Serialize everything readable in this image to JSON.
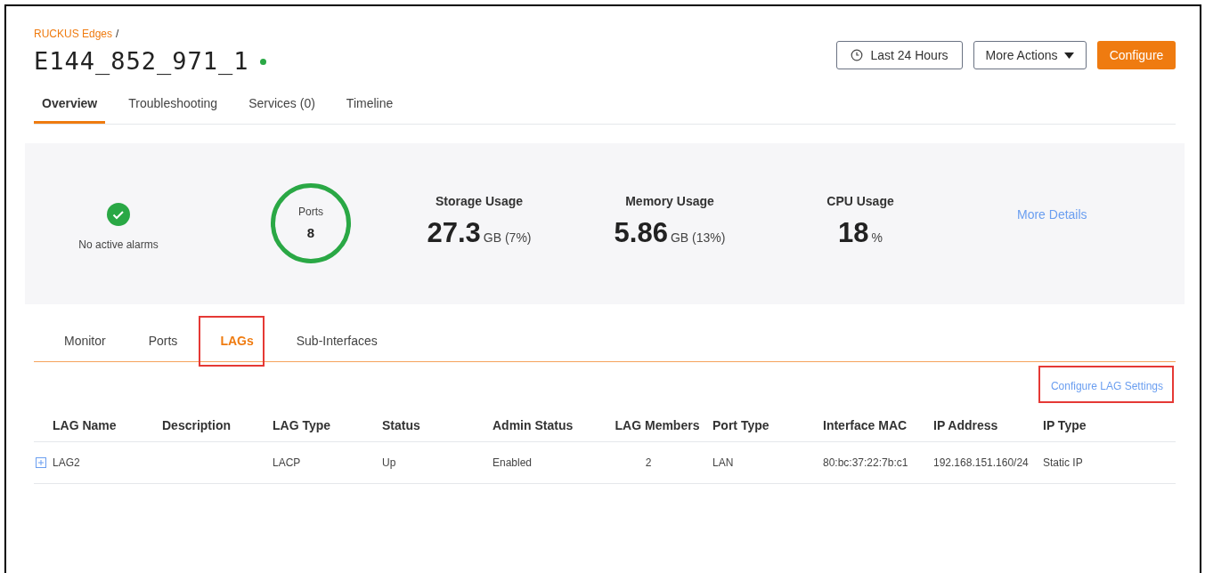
{
  "breadcrumb": {
    "link": "RUCKUS Edges",
    "separator": "/"
  },
  "device": {
    "name": "E144_852_971_1",
    "online": true
  },
  "header_buttons": [
    {
      "kind": "time",
      "label": "Last 24 Hours"
    },
    {
      "kind": "dropdown",
      "label": "More Actions"
    },
    {
      "kind": "primary",
      "label": "Configure"
    }
  ],
  "tabs": [
    {
      "label": "Overview",
      "selected": true
    },
    {
      "label": "Troubleshooting",
      "selected": false
    },
    {
      "label": "Services (0)",
      "selected": false
    },
    {
      "label": "Timeline",
      "selected": false
    }
  ],
  "summary": {
    "alarms": {
      "ok": true,
      "label": "No active alarms"
    },
    "ports": {
      "label": "Ports",
      "value": "8"
    },
    "metrics": [
      {
        "title": "Storage Usage",
        "value": "27.3",
        "unit": "GB (7%)"
      },
      {
        "title": "Memory Usage",
        "value": "5.86",
        "unit": "GB (13%)"
      },
      {
        "title": "CPU Usage",
        "value": "18",
        "unit": "%"
      }
    ],
    "link": "More Details"
  },
  "sub_tabs": [
    {
      "label": "Monitor",
      "selected": false,
      "highlighted": false
    },
    {
      "label": "Ports",
      "selected": false,
      "highlighted": false
    },
    {
      "label": "LAGs",
      "selected": true,
      "highlighted": true
    },
    {
      "label": "Sub-Interfaces",
      "selected": false,
      "highlighted": false
    }
  ],
  "settings_link": {
    "label": "Configure LAG Settings",
    "highlighted": true
  },
  "table": {
    "columns": [
      "LAG Name",
      "Description",
      "LAG Type",
      "Status",
      "Admin Status",
      "LAG Members",
      "Port Type",
      "Interface MAC",
      "IP Address",
      "IP Type"
    ],
    "rows": [
      {
        "expandable": true,
        "cells": [
          "LAG2",
          "",
          "LACP",
          "Up",
          "Enabled",
          "2",
          "LAN",
          "80:bc:37:22:7b:c1",
          "192.168.151.160/24",
          "Static IP"
        ]
      }
    ]
  }
}
